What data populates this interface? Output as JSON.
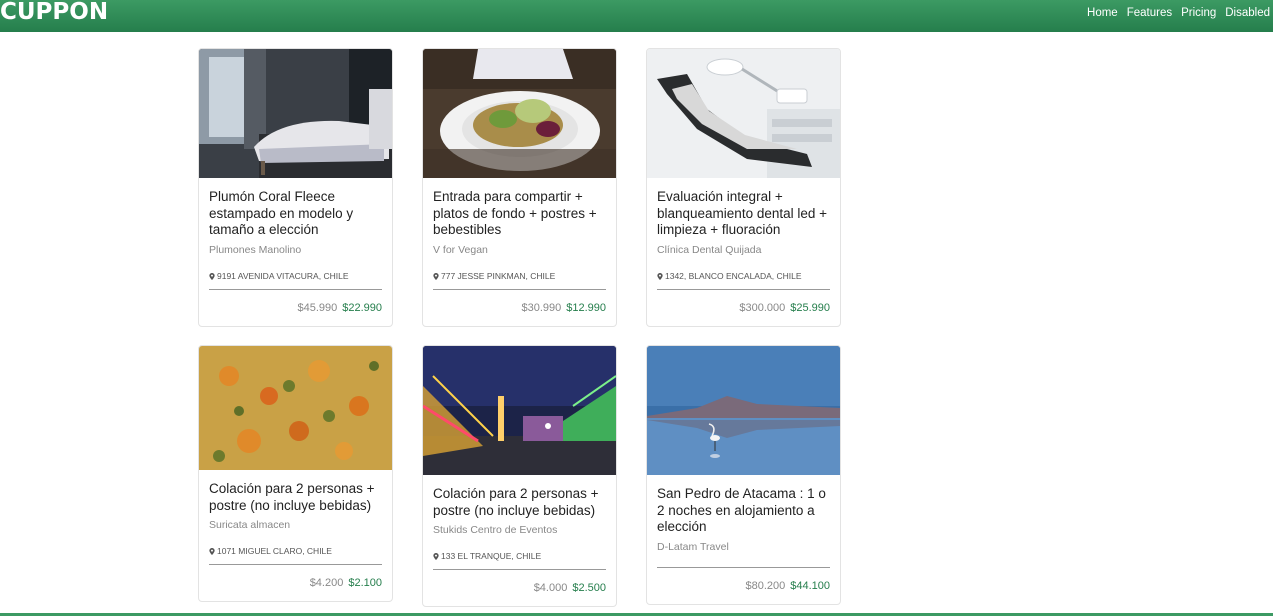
{
  "brand": "CUPPON",
  "nav": {
    "home": "Home",
    "features": "Features",
    "pricing": "Pricing",
    "disabled": "Disabled"
  },
  "colors": {
    "primary": "#257e4c",
    "price_new": "#257e4c",
    "price_old": "#888888"
  },
  "cards": [
    {
      "title": "Plumón Coral Fleece estampado en modelo y tamaño a elección",
      "vendor": "Plumones Manolino",
      "location": "9191 AVENIDA VITACURA, CHILE",
      "old_price": "$45.990",
      "new_price": "$22.990",
      "image": "bedroom-photo"
    },
    {
      "title": "Entrada para compartir + platos de fondo + postres + bebestibles",
      "vendor": "V for Vegan",
      "location": "777 JESSE PINKMAN, CHILE",
      "old_price": "$30.990",
      "new_price": "$12.990",
      "image": "salad-bowl-photo"
    },
    {
      "title": "Evaluación integral + blanqueamiento dental led + limpieza + fluoración",
      "vendor": "Clínica Dental Quijada",
      "location": "1342, BLANCO ENCALADA, CHILE",
      "old_price": "$300.000",
      "new_price": "$25.990",
      "image": "dental-chair-photo"
    },
    {
      "title": "Colación para 2 personas + postre (no incluye bebidas)",
      "vendor": "Suricata almacen",
      "location": "1071 MIGUEL CLARO, CHILE",
      "old_price": "$4.200",
      "new_price": "$2.100",
      "image": "food-dish-photo"
    },
    {
      "title": "Colación para 2 personas + postre (no incluye bebidas)",
      "vendor": "Stukids Centro de Eventos",
      "location": "133 EL TRANQUE, CHILE",
      "old_price": "$4.000",
      "new_price": "$2.500",
      "image": "night-fair-photo"
    },
    {
      "title": "San Pedro de Atacama : 1 o 2 noches en alojamiento a elección",
      "vendor": "D-Latam Travel",
      "location": "",
      "old_price": "$80.200",
      "new_price": "$44.100",
      "image": "lake-flamingo-photo"
    }
  ]
}
